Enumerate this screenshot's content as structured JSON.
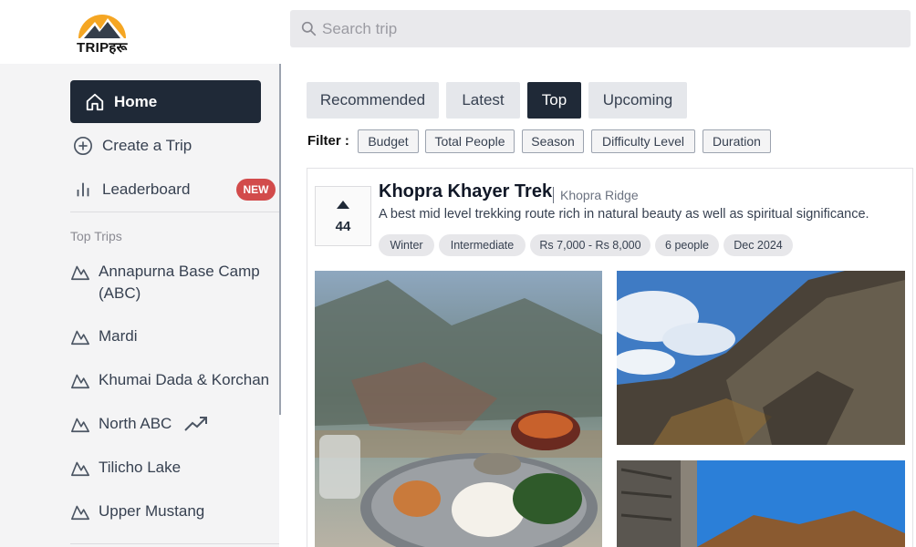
{
  "brand": {
    "logo_text": "TRIPहरू"
  },
  "search": {
    "placeholder": "Search trip",
    "value": ""
  },
  "sidebar": {
    "home": "Home",
    "create": "Create a Trip",
    "leaderboard": "Leaderboard",
    "new_badge": "NEW",
    "top_trips_title": "Top Trips",
    "top_trips": [
      "Annapurna Base Camp",
      "(ABC)",
      "Mardi",
      "Khumai Dada & Korchan",
      "North ABC",
      "Tilicho Lake",
      "Upper Mustang"
    ]
  },
  "tabs": [
    "Recommended",
    "Latest",
    "Top",
    "Upcoming"
  ],
  "active_tab": "Top",
  "filter": {
    "label": "Filter :",
    "chips": [
      "Budget",
      "Total People",
      "Season",
      "Difficulty Level",
      "Duration"
    ]
  },
  "post": {
    "votes": "44",
    "title": "Khopra Khayer Trek",
    "location": "Khopra Ridge",
    "description": "A best mid level trekking route rich in natural beauty as well as spiritual significance.",
    "tags": [
      "Winter",
      "Intermediate",
      "Rs 7,000 - Rs 8,000",
      "6 people",
      "Dec 2024"
    ]
  },
  "colors": {
    "dark": "#1f2937",
    "badge": "#d24b4b",
    "sidebar_bg": "#f4f4f5"
  }
}
